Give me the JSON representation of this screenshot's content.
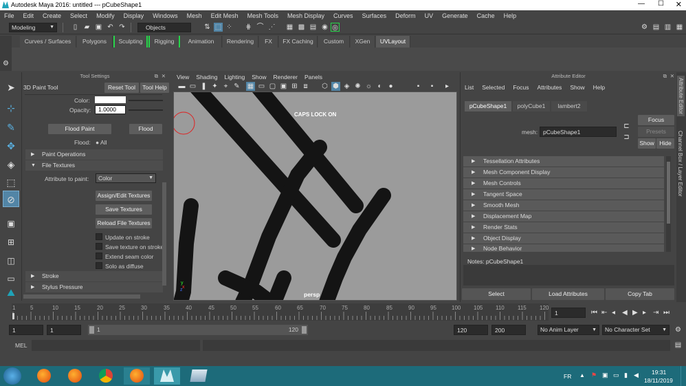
{
  "window": {
    "title": "Autodesk Maya 2016: untitled   ---   pCubeShape1",
    "caps": "CAPS LOCK ON",
    "camera": "persp"
  },
  "menubar": [
    "File",
    "Edit",
    "Create",
    "Select",
    "Modify",
    "Display",
    "Windows",
    "Mesh",
    "Edit Mesh",
    "Mesh Tools",
    "Mesh Display",
    "Curves",
    "Surfaces",
    "Deform",
    "UV",
    "Generate",
    "Cache",
    "Help"
  ],
  "status": {
    "mode": "Modeling",
    "objects": "Objects"
  },
  "shelf": {
    "tabs": [
      "Curves / Surfaces",
      "Polygons",
      "Sculpting",
      "Rigging",
      "Animation",
      "Rendering",
      "FX",
      "FX Caching",
      "Custom",
      "XGen",
      "UVLayout"
    ],
    "active": "UVLayout"
  },
  "toolsettings": {
    "header": "Tool Settings",
    "tool_name": "3D Paint Tool",
    "reset": "Reset Tool",
    "help": "Tool Help",
    "color_label": "Color:",
    "opacity_label": "Opacity:",
    "opacity_value": "1.0000",
    "flood_paint": "Flood Paint",
    "flood": "Flood",
    "flood_label": "Flood:",
    "flood_all": "All",
    "sections": {
      "paint_ops": "Paint Operations",
      "file_textures": "File Textures",
      "stroke": "Stroke",
      "stylus": "Stylus Pressure"
    },
    "attr_to_paint_label": "Attribute to paint:",
    "attr_to_paint_value": "Color",
    "assign_edit": "Assign/Edit Textures",
    "save_textures": "Save Textures",
    "reload": "Reload File Textures",
    "checks": [
      "Update on stroke",
      "Save texture on stroke",
      "Extend seam color",
      "Solo as diffuse"
    ]
  },
  "viewport": {
    "menu": [
      "View",
      "Shading",
      "Lighting",
      "Show",
      "Renderer",
      "Panels"
    ]
  },
  "attr": {
    "header": "Attribute Editor",
    "menu": [
      "List",
      "Selected",
      "Focus",
      "Attributes",
      "Show",
      "Help"
    ],
    "tabs": [
      "pCubeShape1",
      "polyCube1",
      "lambert2"
    ],
    "mesh_label": "mesh:",
    "mesh_value": "pCubeShape1",
    "focus": "Focus",
    "presets": "Presets",
    "show": "Show",
    "hide": "Hide",
    "sections": [
      "Tessellation Attributes",
      "Mesh Component Display",
      "Mesh Controls",
      "Tangent Space",
      "Smooth Mesh",
      "Displacement Map",
      "Render Stats",
      "Object Display",
      "Node Behavior"
    ],
    "notes": "Notes:  pCubeShape1",
    "select": "Select",
    "load": "Load Attributes",
    "copy": "Copy Tab",
    "side": [
      "Attribute Editor",
      "Channel Box / Layer Editor"
    ]
  },
  "time": {
    "ticks": [
      "1",
      "5",
      "10",
      "15",
      "20",
      "25",
      "30",
      "35",
      "40",
      "45",
      "50",
      "55",
      "60",
      "65",
      "70",
      "75",
      "80",
      "85",
      "90",
      "95",
      "100",
      "105",
      "110",
      "115",
      "120"
    ],
    "current": "1",
    "start": "1",
    "start2": "1",
    "range_start": "1",
    "range_end": "120",
    "end": "120",
    "end2": "200",
    "anim_layer": "No Anim Layer",
    "char_set": "No Character Set"
  },
  "cmd": {
    "label": "MEL"
  },
  "taskbar": {
    "lang": "FR",
    "time": "19:31",
    "date": "18/11/2019"
  },
  "colors": {
    "bg": "#444444",
    "viewport": "#9b9b9b",
    "accent": "#5285a6",
    "taskbar": "#1d6b7a"
  }
}
